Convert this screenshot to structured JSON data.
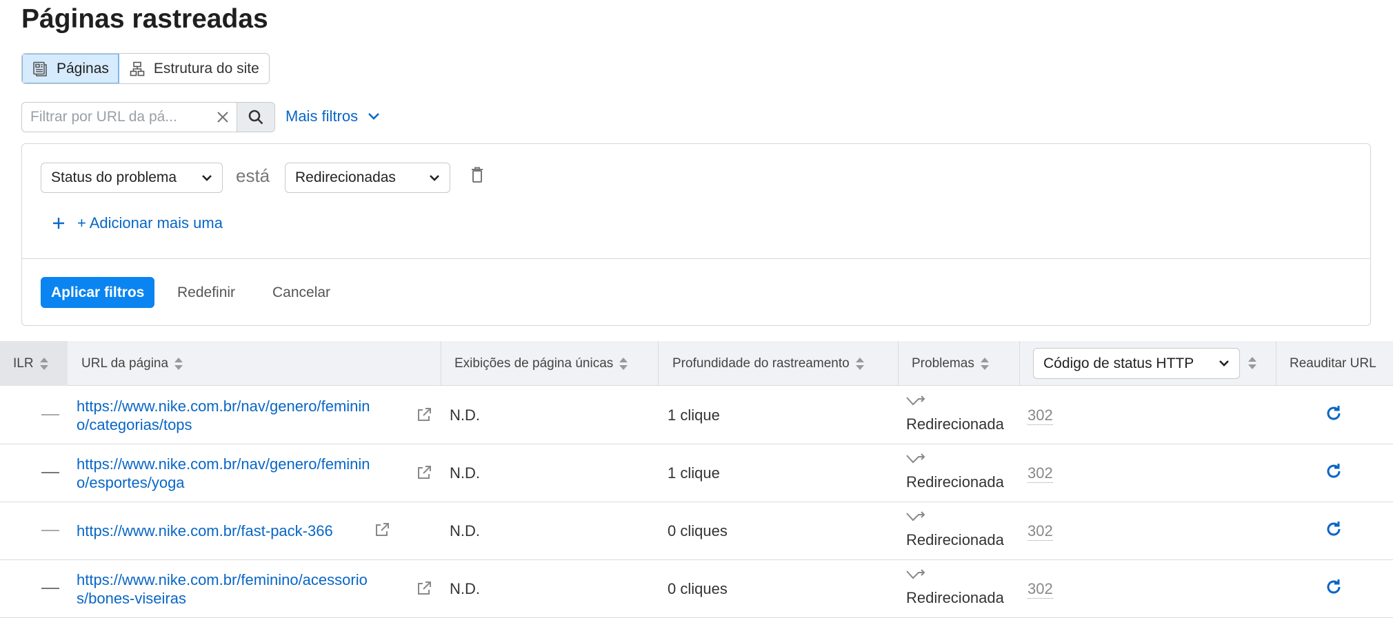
{
  "page": {
    "title": "Páginas rastreadas"
  },
  "view_toggle": {
    "pages_label": "Páginas",
    "structure_label": "Estrutura do site",
    "active": "pages"
  },
  "search": {
    "placeholder": "Filtrar por URL da pá..."
  },
  "more_filters": {
    "label": "Mais filtros"
  },
  "filter_panel": {
    "field": "Status do problema",
    "operator": "está",
    "value": "Redirecionadas",
    "add_more": "+ Adicionar mais uma",
    "apply": "Aplicar filtros",
    "reset": "Redefinir",
    "cancel": "Cancelar"
  },
  "table": {
    "columns": {
      "ilr": "ILR",
      "url": "URL da página",
      "views": "Exibições de página únicas",
      "depth": "Profundidade do rastreamento",
      "issues": "Problemas",
      "http": "Código de status HTTP",
      "reaudit": "Reauditar URL"
    },
    "rows": [
      {
        "url_line1": "https://www.nike.com.br/nav/genero/feminin",
        "url_line2": "o/categorias/tops",
        "views": "N.D.",
        "depth": "1 clique",
        "issue": "Redirecionada",
        "code": "302"
      },
      {
        "url_line1": "https://www.nike.com.br/nav/genero/feminin",
        "url_line2": "o/esportes/yoga",
        "views": "N.D.",
        "depth": "1 clique",
        "issue": "Redirecionada",
        "code": "302"
      },
      {
        "url_line1": "https://www.nike.com.br/fast-pack-366",
        "url_line2": "",
        "views": "N.D.",
        "depth": "0 cliques",
        "issue": "Redirecionada",
        "code": "302"
      },
      {
        "url_line1": "https://www.nike.com.br/feminino/acessorio",
        "url_line2": "s/bones-viseiras",
        "views": "N.D.",
        "depth": "0 cliques",
        "issue": "Redirecionada",
        "code": "302"
      }
    ]
  },
  "colors": {
    "link": "#0866c6",
    "primary_button": "#0a84f0",
    "active_toggle": "#d6ebfd"
  }
}
